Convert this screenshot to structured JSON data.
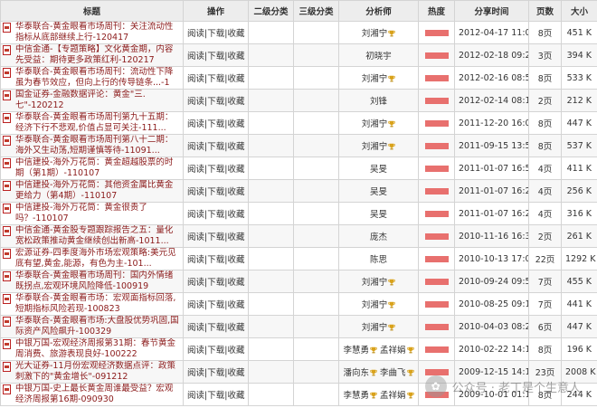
{
  "headers": {
    "title": "标题",
    "ops": "操作",
    "cat2": "二级分类",
    "cat3": "三级分类",
    "analyst": "分析师",
    "heat": "热度",
    "time": "分享时间",
    "pages": "页数",
    "size": "大小"
  },
  "ops": {
    "read": "阅读",
    "download": "下载",
    "fav": "收藏",
    "sep": "|"
  },
  "colors": {
    "heat": "#e8706e",
    "title": "#8b1a1a",
    "header_bg": "#ededed"
  },
  "rows": [
    {
      "title": "华泰联合-黄金眼看市场周刊：关注流动性指标从底部继续上行-120417",
      "analyst": "刘湘宁",
      "trophies": 1,
      "time": "2012-04-17 11:04:43",
      "pages": "8页",
      "size": "451 K"
    },
    {
      "title": "中信金通-【专题策略】文化黄金期，内容先受益：期待更多政策红利-120217",
      "analyst": "初晓宇",
      "trophies": 0,
      "time": "2012-02-18 09:21:54",
      "pages": "3页",
      "size": "394 K"
    },
    {
      "title": "华泰联合-黄金眼看市场周刊：流动性下降虽为春节效应，但向上行的传导链条...-1",
      "analyst": "刘湘宁",
      "trophies": 1,
      "time": "2012-02-16 08:56:41",
      "pages": "8页",
      "size": "533 K"
    },
    {
      "title": "国金证券-金融数据评论：黄金\"三.七\"-120212",
      "analyst": "刘锋",
      "trophies": 0,
      "time": "2012-02-14 08:17:00",
      "pages": "2页",
      "size": "212 K"
    },
    {
      "title": "华泰联合-黄金眼看市场周刊第九十五期：经济下行不悲观,价值占显可关注-111...",
      "analyst": "刘湘宁",
      "trophies": 1,
      "time": "2011-12-20 16:08:07",
      "pages": "8页",
      "size": "447 K"
    },
    {
      "title": "华泰联合-黄金眼看市场周刊第八十二期：海外又生动荡,短期谨慎等待-11091...",
      "analyst": "刘湘宁",
      "trophies": 1,
      "time": "2011-09-15 13:57:49",
      "pages": "8页",
      "size": "537 K"
    },
    {
      "title": "中信建投-海外万花筒：黄金超越股票的时期（第1期）-110107",
      "analyst": "吴旻",
      "trophies": 0,
      "time": "2011-01-07 16:51:00",
      "pages": "4页",
      "size": "411 K"
    },
    {
      "title": "中信建投-海外万花筒：其他资金属比黄金更给力（第4期）-110107",
      "analyst": "吴旻",
      "trophies": 0,
      "time": "2011-01-07 16:21:30",
      "pages": "4页",
      "size": "256 K"
    },
    {
      "title": "中信建投-海外万花筒：黄金很贵了吗？-110107",
      "analyst": "吴旻",
      "trophies": 0,
      "time": "2011-01-07 16:20:51",
      "pages": "4页",
      "size": "316 K"
    },
    {
      "title": "中信金通-黄金股专题跟踪报告之五：量化宽松政策推动黄金继续创出新高-1011...",
      "analyst": "庞杰",
      "trophies": 0,
      "time": "2010-11-16 16:33:54",
      "pages": "2页",
      "size": "261 K"
    },
    {
      "title": "宏源证券-四季度海外市场宏观策略:美元见底有望,黄金,能源，有色为主-101...",
      "analyst": "陈思",
      "trophies": 0,
      "time": "2010-10-13 17:03:50",
      "pages": "22页",
      "size": "1292 K"
    },
    {
      "title": "华泰联合-黄金眼看市场周刊：国内外情绪既拐点,宏观环境风险降低-100919",
      "analyst": "刘湘宁",
      "trophies": 1,
      "time": "2010-09-24 09:55:50",
      "pages": "7页",
      "size": "455 K"
    },
    {
      "title": "华泰联合-黄金眼看市场：宏观面指标回落,短期指标风险若现-100823",
      "analyst": "刘湘宁",
      "trophies": 1,
      "time": "2010-08-25 09:14:50",
      "pages": "7页",
      "size": "441 K"
    },
    {
      "title": "华泰联合-黄金眼看市场:大盘股优势巩固,国际资产风险飙升-100329",
      "analyst": "刘湘宁",
      "trophies": 1,
      "time": "2010-04-03 08:21:37",
      "pages": "6页",
      "size": "447 K"
    },
    {
      "title": "中银万国-宏观经济周报第31期：春节黄金周消费、旅游表现良好-100222",
      "analyst": "李慧勇  孟祥娟",
      "trophies": 2,
      "time": "2010-02-22 14:18:27",
      "pages": "8页",
      "size": "196 K"
    },
    {
      "title": "光大证券-11月份宏观经济数据点评：政策刺激下的\"黄金增长\"-091212",
      "analyst": "潘向东  李曲飞",
      "trophies": 2,
      "time": "2009-12-15 14:14:25",
      "pages": "23页",
      "size": "2008 K"
    },
    {
      "title": "中银万国-史上最长黄金周谁最受益？宏观经济周报第16期-090930",
      "analyst": "李慧勇  孟祥娟",
      "trophies": 2,
      "time": "2009-10-01 01:17:33",
      "pages": "8页",
      "size": "244 K"
    }
  ],
  "watermark": {
    "text": "公众号 · 老丁是个生意人",
    "logo_char": "✿"
  }
}
